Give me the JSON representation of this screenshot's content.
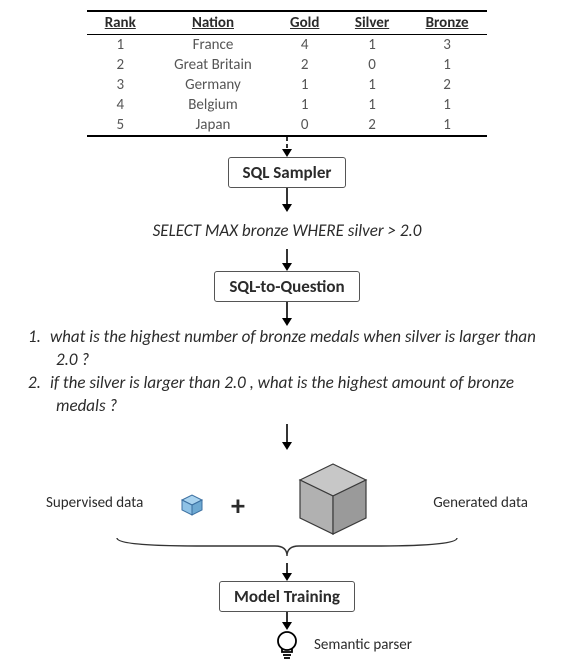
{
  "chart_data": {
    "type": "table",
    "columns": [
      "Rank",
      "Nation",
      "Gold",
      "Silver",
      "Bronze"
    ],
    "rows": [
      [
        1,
        "France",
        4,
        1,
        3
      ],
      [
        2,
        "Great Britain",
        2,
        0,
        1
      ],
      [
        3,
        "Germany",
        1,
        1,
        2
      ],
      [
        4,
        "Belgium",
        1,
        1,
        1
      ],
      [
        5,
        "Japan",
        0,
        2,
        1
      ]
    ]
  },
  "steps": {
    "sampler": "SQL Sampler",
    "sql2q": "SQL-to-Question",
    "training": "Model Training"
  },
  "sql_query": "SELECT MAX bronze WHERE silver > 2.0",
  "questions": [
    "what is the highest number of bronze medals when silver is larger than 2.0 ?",
    "if the silver is larger than 2.0 , what is the highest amount of bronze medals ?"
  ],
  "labels": {
    "supervised": "Supervised data",
    "generated": "Generated data",
    "plus": "+",
    "output": "Semantic parser"
  }
}
